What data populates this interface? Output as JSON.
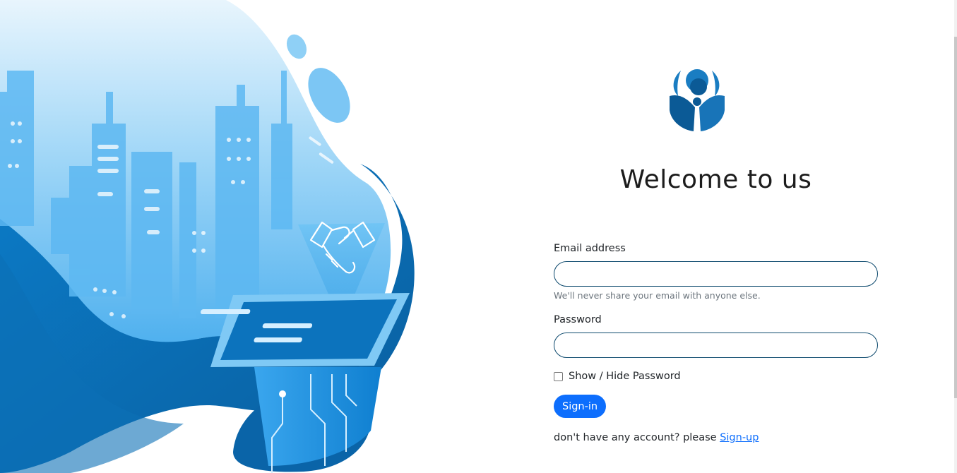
{
  "colors": {
    "accent": "#0d6efd",
    "input_border": "#0e4a6e",
    "illustration_dark": "#0a6fb8",
    "illustration_light": "#5cb8f2"
  },
  "hero": {
    "illustration": "city-handshake-illustration"
  },
  "brand": {
    "logo": "people-hands-logo"
  },
  "title": "Welcome to us",
  "form": {
    "email_label": "Email address",
    "email_value": "",
    "email_help": "We'll never share your email with anyone else.",
    "password_label": "Password",
    "password_value": "",
    "show_password_label": "Show / Hide Password",
    "show_password_checked": false,
    "submit_label": "Sign-in"
  },
  "signup": {
    "prompt": "don't have any account? please ",
    "link_label": "Sign-up"
  }
}
